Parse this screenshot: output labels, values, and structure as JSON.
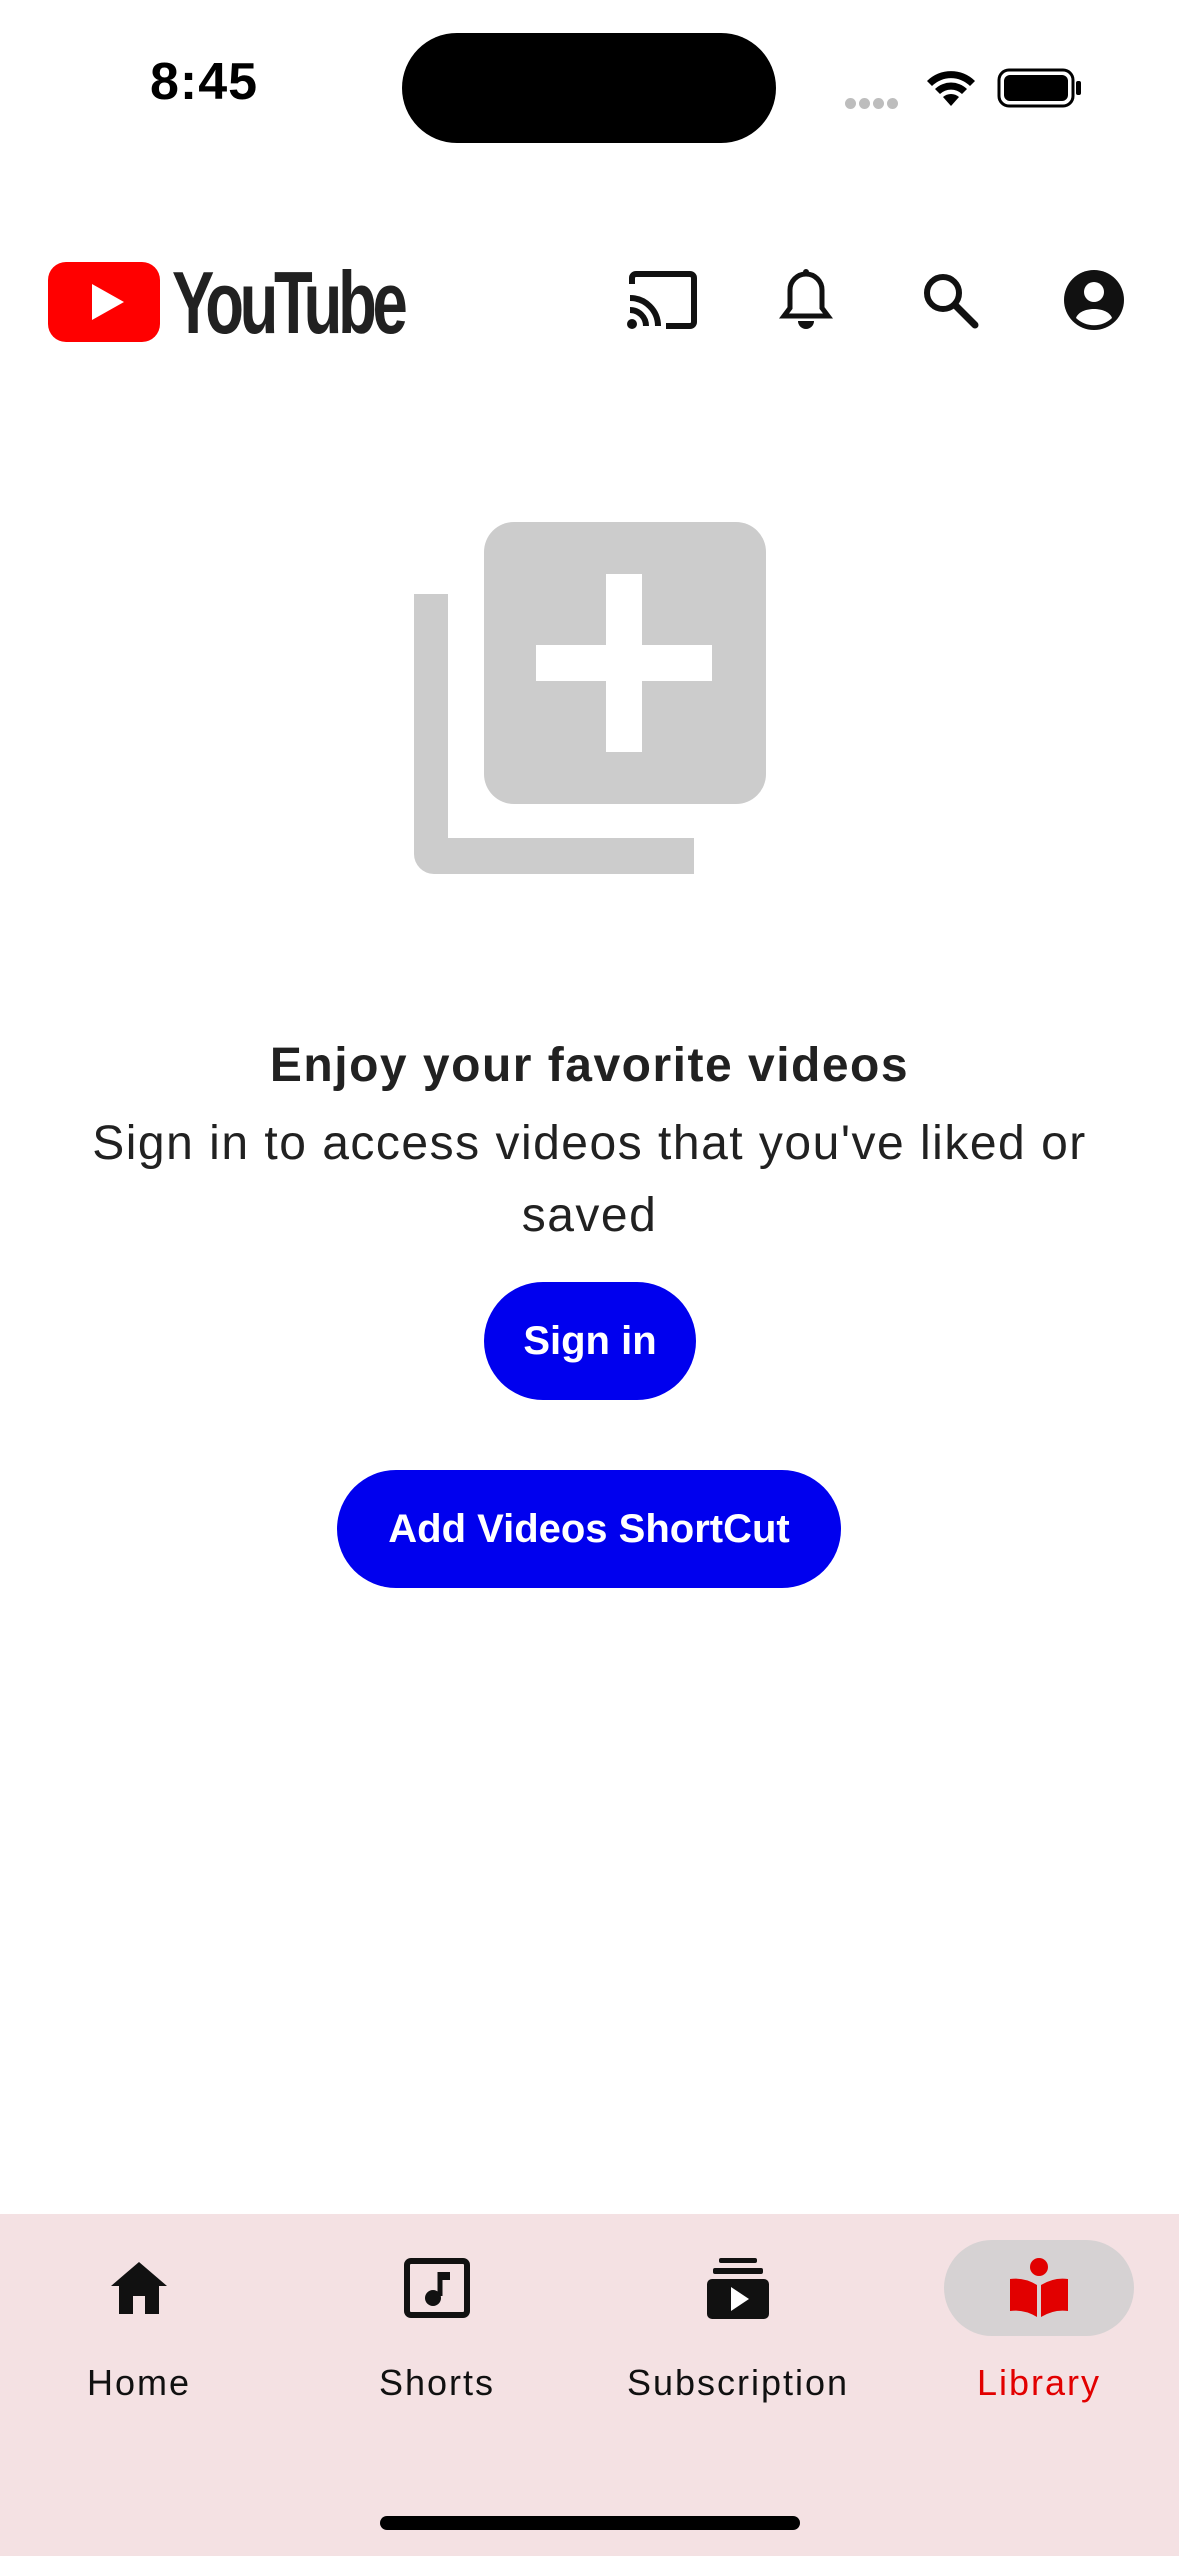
{
  "status_bar": {
    "time": "8:45"
  },
  "header": {
    "wordmark": "YouTube"
  },
  "empty_state": {
    "title": "Enjoy your favorite videos",
    "description": "Sign in to access videos that you've liked or saved"
  },
  "buttons": {
    "sign_in": "Sign in",
    "add_shortcut": "Add Videos ShortCut"
  },
  "bottom_nav": {
    "items": [
      {
        "label": "Home",
        "icon": "home-icon",
        "active": false
      },
      {
        "label": "Shorts",
        "icon": "shorts-icon",
        "active": false
      },
      {
        "label": "Subscription",
        "icon": "subscriptions-icon",
        "active": false
      },
      {
        "label": "Library",
        "icon": "library-icon",
        "active": true
      }
    ]
  },
  "colors": {
    "brand_red": "#ff0000",
    "button_blue": "#0000ee",
    "nav_background": "#f4e1e3",
    "active_nav": "#e20000",
    "illustration_gray": "#cccccc"
  }
}
